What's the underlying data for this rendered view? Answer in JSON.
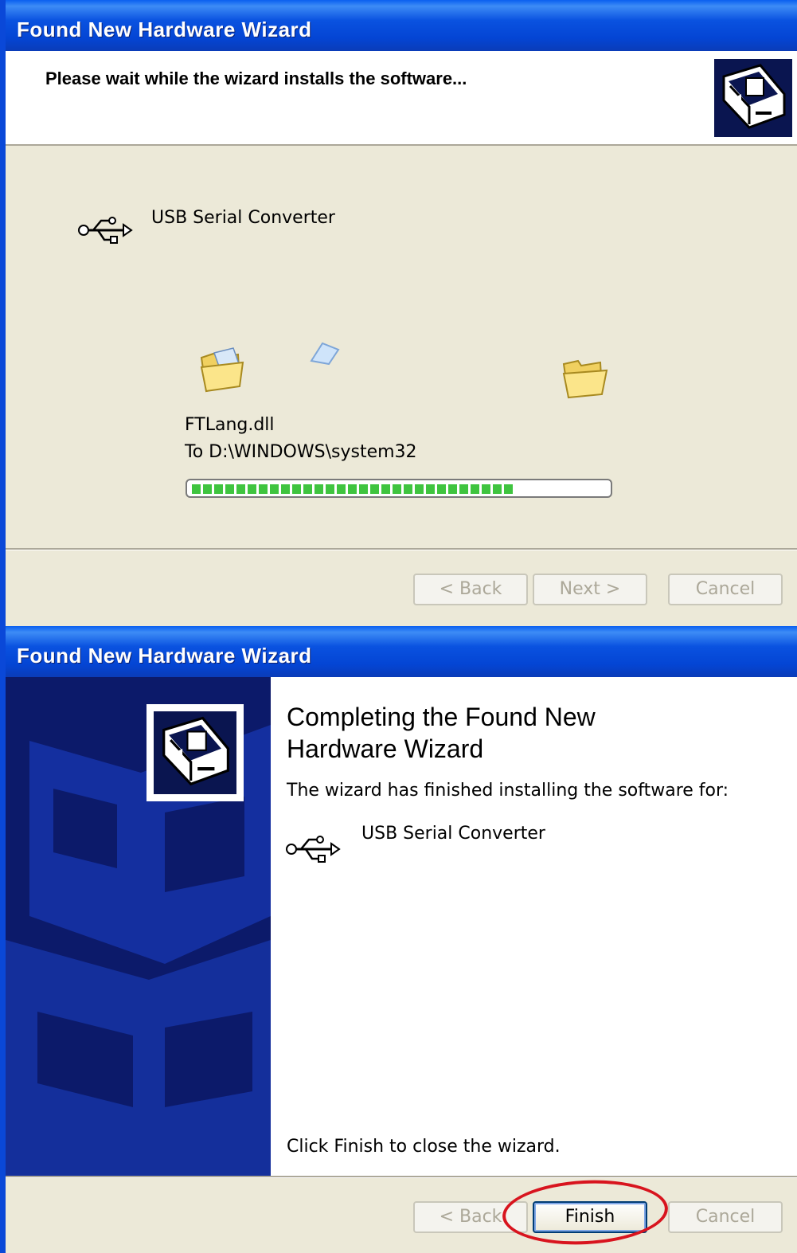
{
  "window1": {
    "title": "Found New Hardware Wizard",
    "header": "Please wait while the wizard installs the software...",
    "device_icon": "usb-icon",
    "device": "USB Serial Converter",
    "file_name": "FTLang.dll",
    "destination": "To D:\\WINDOWS\\system32",
    "progress_fraction": 0.78,
    "buttons": {
      "back": "< Back",
      "next": "Next >",
      "cancel": "Cancel"
    }
  },
  "window2": {
    "title": "Found New Hardware Wizard",
    "heading_line1": "Completing the Found New",
    "heading_line2": "Hardware Wizard",
    "message": "The wizard has finished installing the software for:",
    "device_icon": "usb-icon",
    "device": "USB Serial Converter",
    "closing": "Click Finish to close the wizard.",
    "buttons": {
      "back": "< Back",
      "finish": "Finish",
      "cancel": "Cancel"
    },
    "annotation_color": "#d8141e"
  }
}
